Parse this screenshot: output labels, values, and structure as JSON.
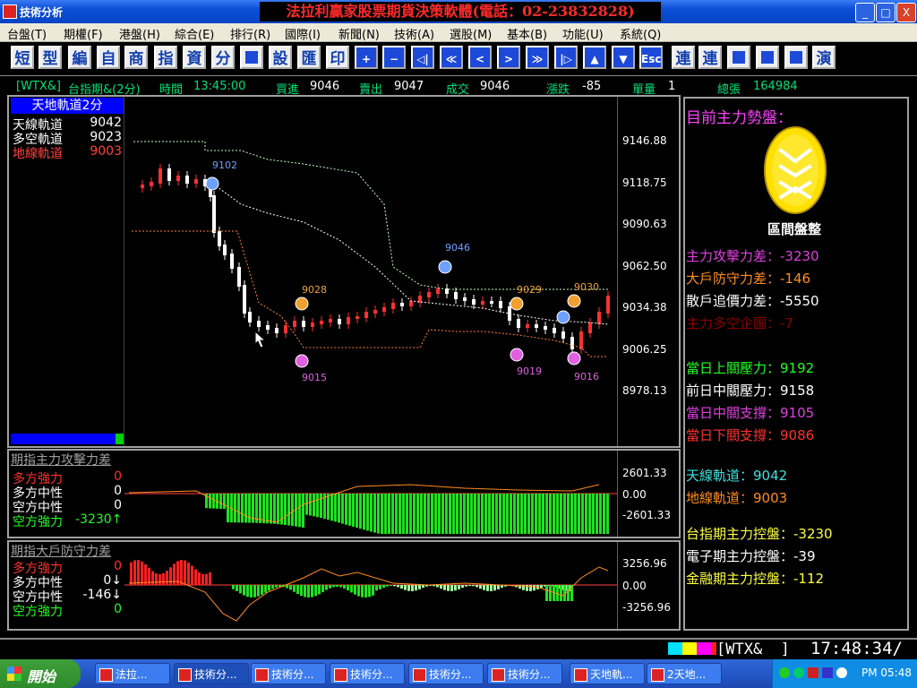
{
  "window": {
    "title": "技術分析",
    "banner": "法拉利贏家股票期貨決策軟體(電話：02-23832828)",
    "minimize": "_",
    "maximize": "□",
    "close": "X"
  },
  "menu": [
    "台盤(T)",
    "期權(F)",
    "港盤(H)",
    "綜合(E)",
    "排行(R)",
    "國際(I)",
    "新聞(N)",
    "技術(A)",
    "選股(M)",
    "基本(B)",
    "功能(U)",
    "系統(Q)"
  ],
  "toolbar": [
    "短",
    "型",
    "編",
    "自",
    "商",
    "指",
    "資",
    "分",
    "",
    "設",
    "匯",
    "印",
    "+",
    "−",
    "◁|",
    "≪",
    "<",
    ">",
    "≫",
    "|▷",
    "▲",
    "▼",
    "Esc",
    "連",
    "連",
    "",
    "",
    "",
    "演"
  ],
  "status": {
    "symbol": "[WTX&]",
    "name": "台指期&(2分)",
    "time_label": "時間",
    "time": "13:45:00",
    "bid_label": "買進",
    "bid": "9046",
    "ask_label": "賣出",
    "ask": "9047",
    "last_label": "成交",
    "last": "9046",
    "change_label": "漲跌",
    "change": "-85",
    "volume_label": "單量",
    "volume": "1",
    "total_label": "總張",
    "total": "164984"
  },
  "main_chart": {
    "title": "天地軌道2分",
    "rows": [
      {
        "label": "天線軌道",
        "value": "9042",
        "color": "#ffffff"
      },
      {
        "label": "多空軌道",
        "value": "9023",
        "color": "#ffffff"
      },
      {
        "label": "地線軌道",
        "value": "9003",
        "color": "#ff4040"
      }
    ],
    "y_ticks": [
      "9146.88",
      "9118.75",
      "9090.63",
      "9062.50",
      "9034.38",
      "9006.25",
      "8978.13"
    ],
    "markers": [
      "9102",
      "9046",
      "9028",
      "9029",
      "9030",
      "9015",
      "9019",
      "9016"
    ]
  },
  "sub1": {
    "title": "期指主力攻擊力差",
    "rows": [
      {
        "label": "多方強力",
        "value": "0",
        "color": "#ff3030"
      },
      {
        "label": "多方中性",
        "value": "0",
        "color": "#ffffff"
      },
      {
        "label": "空方中性",
        "value": "0",
        "color": "#ffffff"
      },
      {
        "label": "空方強力",
        "value": "-3230↑",
        "color": "#20ff20"
      }
    ],
    "y_ticks": [
      "2601.33",
      "0.00",
      "-2601.33"
    ]
  },
  "sub2": {
    "title": "期指大戶防守力差",
    "rows": [
      {
        "label": "多方強力",
        "value": "0",
        "color": "#ff3030"
      },
      {
        "label": "多方中性",
        "value": "0↓",
        "color": "#ffffff"
      },
      {
        "label": "空方中性",
        "value": "-146↓",
        "color": "#ffffff"
      },
      {
        "label": "空方強力",
        "value": "0",
        "color": "#20ff20"
      }
    ],
    "y_ticks": [
      "3256.96",
      "0.00",
      "-3256.96"
    ]
  },
  "right_panel": {
    "heading": "目前主力勢盤：",
    "badge_label": "區間盤整",
    "items1": [
      {
        "text": "主力攻擊力差：-3230",
        "color": "#e040e0"
      },
      {
        "text": "大戶防守力差：-146",
        "color": "#ff8c20"
      },
      {
        "text": "散戶追價力差：-5550",
        "color": "#ffffff"
      },
      {
        "text": "主力多空企圖：-7",
        "color": "#8b0000"
      }
    ],
    "items2": [
      {
        "text": "當日上關壓力：9192",
        "color": "#20ff20"
      },
      {
        "text": "前日中關壓力：9158",
        "color": "#ffffff"
      },
      {
        "text": "當日中關支撐：9105",
        "color": "#e040e0"
      },
      {
        "text": "當日下關支撐：9086",
        "color": "#ff3030"
      }
    ],
    "items3": [
      {
        "text": "天線軌道：9042",
        "color": "#40e0e0"
      },
      {
        "text": "地線軌道：9003",
        "color": "#ff8c20"
      }
    ],
    "items4": [
      {
        "text": "台指期主力控盤：-3230",
        "color": "#ffff40"
      },
      {
        "text": "電子期主力控盤：-39",
        "color": "#ffffff"
      },
      {
        "text": "金融期主力控盤：-112",
        "color": "#ffff40"
      }
    ]
  },
  "bottom": {
    "symbol": "[WTX&  ]",
    "clock": "17:48:34/"
  },
  "taskbar": {
    "start": "開始",
    "tasks": [
      "法拉...",
      "技術分...",
      "技術分...",
      "技術分...",
      "技術分...",
      "技術分...",
      "天地軌...",
      "2天地..."
    ],
    "clock": "PM 05:48"
  }
}
